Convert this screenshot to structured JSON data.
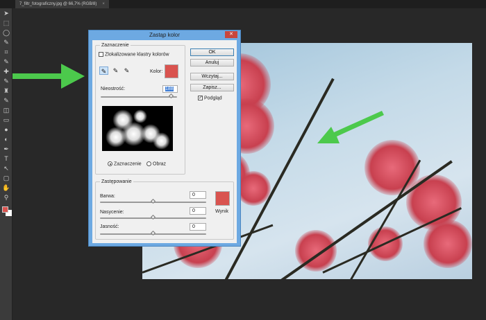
{
  "tab": {
    "title": "7_filtr_fotograficzny.jpg @ 66,7% (RGB/8)",
    "close": "×"
  },
  "tools": [
    "move",
    "marquee",
    "lasso",
    "quick-select",
    "crop",
    "eyedropper",
    "healing",
    "brush",
    "stamp",
    "history-brush",
    "eraser",
    "gradient",
    "blur",
    "dodge",
    "pen",
    "type",
    "path-select",
    "shape",
    "hand",
    "zoom"
  ],
  "dialog": {
    "title": "Zastąp kolor",
    "close": "✕",
    "selection": {
      "legend": "Zaznaczenie",
      "localized_label": "Zlokalizowane klastry kolorów",
      "localized_checked": false,
      "color_label": "Kolor:",
      "color": "#d9534f",
      "fuzziness_label": "Nieostrość:",
      "fuzziness": "188",
      "fuzziness_max": 200,
      "radio_selection": "Zaznaczenie",
      "radio_image": "Obraz",
      "radio_selected": "Zaznaczenie"
    },
    "buttons": {
      "ok": "OK",
      "cancel": "Anuluj",
      "load": "Wczytaj...",
      "save": "Zapisz..."
    },
    "preview": {
      "label": "Podgląd",
      "checked": true
    },
    "replacement": {
      "legend": "Zastępowanie",
      "hue_label": "Barwa:",
      "hue": "0",
      "saturation_label": "Nasycenie:",
      "saturation": "0",
      "lightness_label": "Jasność:",
      "lightness": "0",
      "result_label": "Wynik",
      "result_color": "#d9534f"
    }
  },
  "colors": {
    "arrow": "#4cc94c",
    "foreground": "#d9534f",
    "background": "#ffffff"
  }
}
